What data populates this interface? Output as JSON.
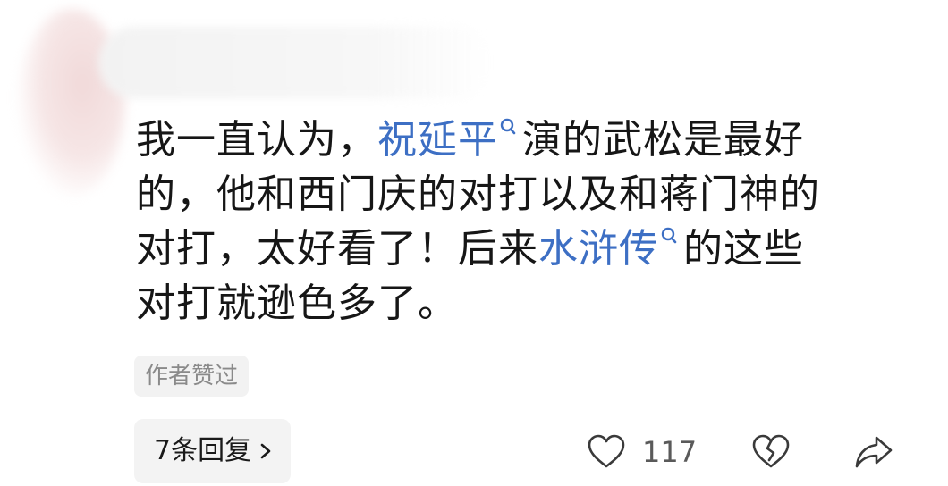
{
  "comment": {
    "line1_a": "我一直认为，",
    "link1": "祝延平",
    "line1_b": "演的武松是最好",
    "line2": "的，他和西门庆的对打以及和蒋门神的",
    "line3_a": "对打，太好看了！后来",
    "link2": "水浒传",
    "line3_b": "的这些",
    "line4": "对打就逊色多了。"
  },
  "badge": {
    "author_liked": "作者赞过"
  },
  "actions": {
    "replies_label": "7条回复",
    "like_count": "117"
  },
  "icons": {
    "keyword_search": "search-icon",
    "replies_chevron": "chevron-right-icon",
    "like": "heart-icon",
    "dislike": "broken-heart-icon",
    "share": "share-icon"
  },
  "colors": {
    "link": "#3d6fc4",
    "badge_bg": "#f2f2f2",
    "badge_text": "#8a8a8a"
  }
}
